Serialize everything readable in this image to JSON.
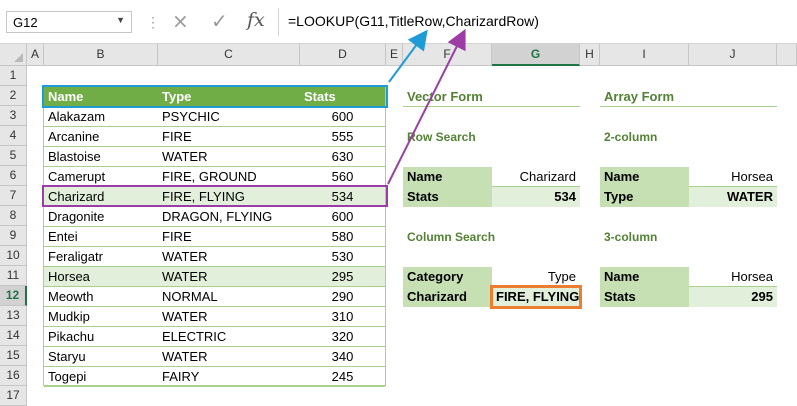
{
  "formula_bar": {
    "name_box": "G12",
    "cancel_icon": "×",
    "enter_icon": "✓",
    "fx_label": "fx",
    "formula": "=LOOKUP(G11,TitleRow,CharizardRow)"
  },
  "columns": [
    "A",
    "B",
    "C",
    "D",
    "E",
    "F",
    "G",
    "H",
    "I",
    "J"
  ],
  "selected_column": "G",
  "rows": [
    "1",
    "2",
    "3",
    "4",
    "5",
    "6",
    "7",
    "8",
    "9",
    "10",
    "11",
    "12",
    "13",
    "14",
    "15",
    "16",
    "17"
  ],
  "selected_row": "12",
  "pokemon_table": {
    "headers": {
      "name": "Name",
      "type": "Type",
      "stats": "Stats"
    },
    "rows": [
      {
        "name": "Alakazam",
        "type": "PSYCHIC",
        "stats": "600"
      },
      {
        "name": "Arcanine",
        "type": "FIRE",
        "stats": "555"
      },
      {
        "name": "Blastoise",
        "type": "WATER",
        "stats": "630"
      },
      {
        "name": "Camerupt",
        "type": "FIRE, GROUND",
        "stats": "560"
      },
      {
        "name": "Charizard",
        "type": "FIRE, FLYING",
        "stats": "534"
      },
      {
        "name": "Dragonite",
        "type": "DRAGON, FLYING",
        "stats": "600"
      },
      {
        "name": "Entei",
        "type": "FIRE",
        "stats": "580"
      },
      {
        "name": "Feraligatr",
        "type": "WATER",
        "stats": "530"
      },
      {
        "name": "Horsea",
        "type": "WATER",
        "stats": "295"
      },
      {
        "name": "Meowth",
        "type": "NORMAL",
        "stats": "290"
      },
      {
        "name": "Mudkip",
        "type": "WATER",
        "stats": "310"
      },
      {
        "name": "Pikachu",
        "type": "ELECTRIC",
        "stats": "320"
      },
      {
        "name": "Staryu",
        "type": "WATER",
        "stats": "340"
      },
      {
        "name": "Togepi",
        "type": "FAIRY",
        "stats": "245"
      }
    ]
  },
  "vector_form": {
    "title": "Vector Form",
    "row_search": {
      "title": "Row Search",
      "name_label": "Name",
      "name_value": "Charizard",
      "stats_label": "Stats",
      "stats_value": "534"
    },
    "column_search": {
      "title": "Column Search",
      "category_label": "Category",
      "category_value": "Type",
      "charizard_label": "Charizard",
      "charizard_value": "FIRE, FLYING"
    }
  },
  "array_form": {
    "title": "Array Form",
    "two_column": {
      "title": "2-column",
      "name_label": "Name",
      "name_value": "Horsea",
      "type_label": "Type",
      "type_value": "WATER"
    },
    "three_column": {
      "title": "3-column",
      "name_label": "Name",
      "name_value": "Horsea",
      "stats_label": "Stats",
      "stats_value": "295"
    }
  },
  "colors": {
    "header_green": "#70ad47",
    "band_green": "#e2efda",
    "label_green": "#c6e0b4",
    "title_green": "#548235",
    "arrow_blue": "#1f9bd7",
    "arrow_purple": "#9b3da5",
    "selection_orange": "#ed7d31"
  }
}
